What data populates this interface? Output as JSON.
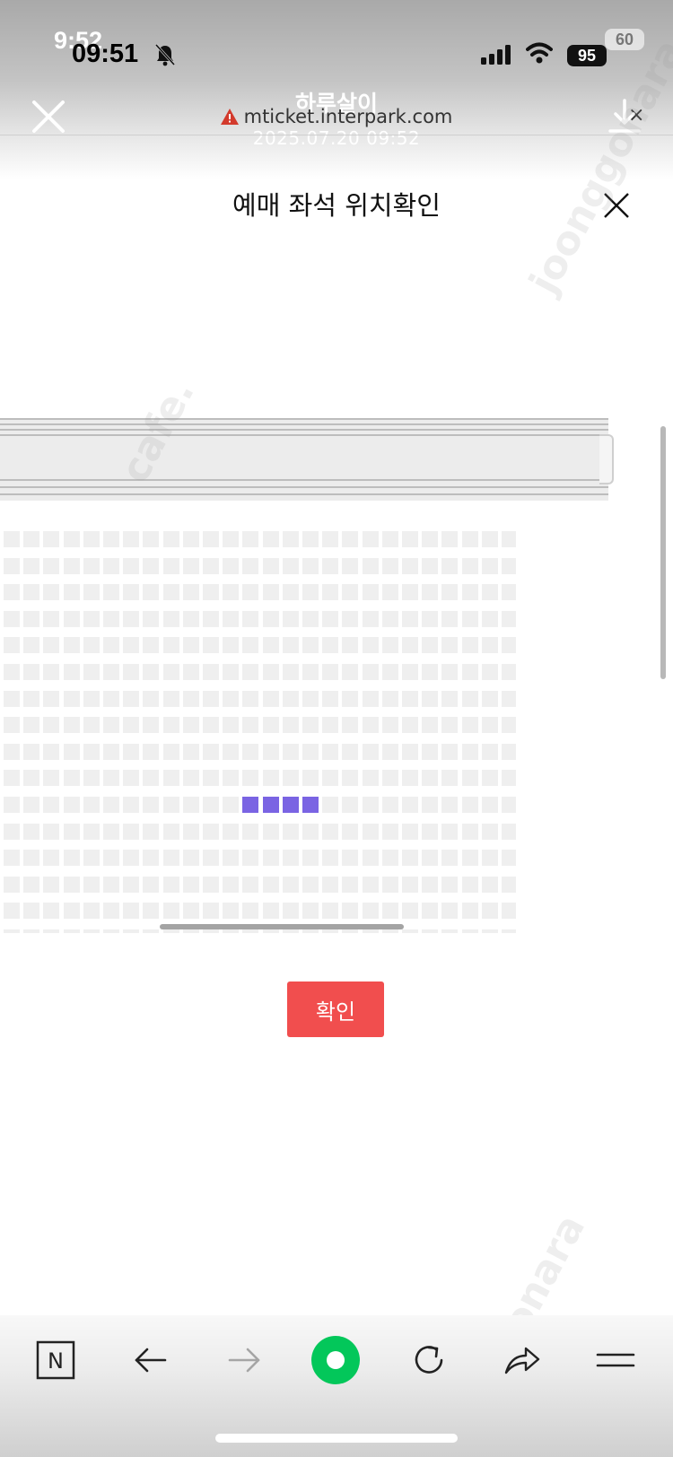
{
  "status_bar": {
    "time": "09:51",
    "time_overlay": "9:52",
    "battery": "95",
    "battery_overlay": "60"
  },
  "viewer": {
    "title": "하루살이",
    "date": "2025.07.20 09:52"
  },
  "browser": {
    "url": "mticket.interpark.com",
    "close_symbol": "×"
  },
  "modal": {
    "title": "예매 좌석 위치확인",
    "confirm_label": "확인"
  },
  "seat_map": {
    "columns": 26,
    "rows": 16,
    "selected_row": 10,
    "selected_columns": [
      12,
      13,
      14,
      15
    ]
  },
  "toolbar": {
    "naver_label": "N"
  },
  "colors": {
    "accent_button": "#f14e4e",
    "selected_seat": "#7a64e3",
    "empty_seat": "#efefef",
    "naver_green": "#03c75a"
  }
}
